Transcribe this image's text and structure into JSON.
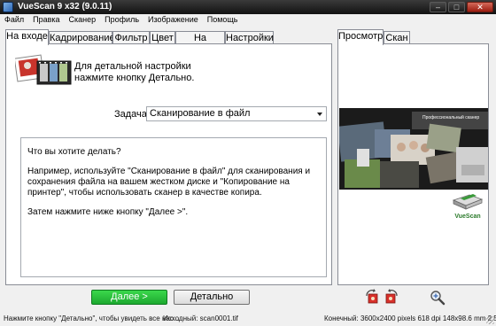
{
  "window": {
    "title": "VueScan 9 x32 (9.0.11)"
  },
  "menu": [
    "Файл",
    "Правка",
    "Сканер",
    "Профиль",
    "Изображение",
    "Помощь"
  ],
  "tabs": [
    "На входе",
    "Кадрирование",
    "Фильтр",
    "Цвет",
    "На выходе",
    "Настройки"
  ],
  "active_tab": "На входе",
  "hint": {
    "line1": "Для детальной настройки",
    "line2": "нажмите кнопку Детально."
  },
  "task": {
    "label": "Задача:",
    "value": "Сканирование в файл"
  },
  "help": {
    "question": "Что вы хотите делать?",
    "example": "Например, используйте \"Сканирование в файл\" для сканирования и сохранения файла на вашем жестком диске и \"Копирование на принтер\", чтобы использовать сканер в качестве копира.",
    "next_step": "Затем нажмите ниже кнопку \"Далее >\"."
  },
  "right_tabs": [
    "Просмотр",
    "Скан"
  ],
  "right_active_tab": "Просмотр",
  "preview": {
    "caption": "Профессиональный сканер",
    "logo": "VueScan"
  },
  "buttons": {
    "next": "Далее >",
    "details": "Детально"
  },
  "status": {
    "hint": "Нажмите кнопку \"Детально\", чтобы увидеть все нас...",
    "source_file": "Исходный: scan0001.tif",
    "final": "Конечный: 3600x2400 pixels 618 dpi 148x98.6 mm 2.5..."
  },
  "colors": {
    "next_button": "#24b536",
    "titlebar": "#1e1e1e",
    "panel_border": "#898c95"
  }
}
